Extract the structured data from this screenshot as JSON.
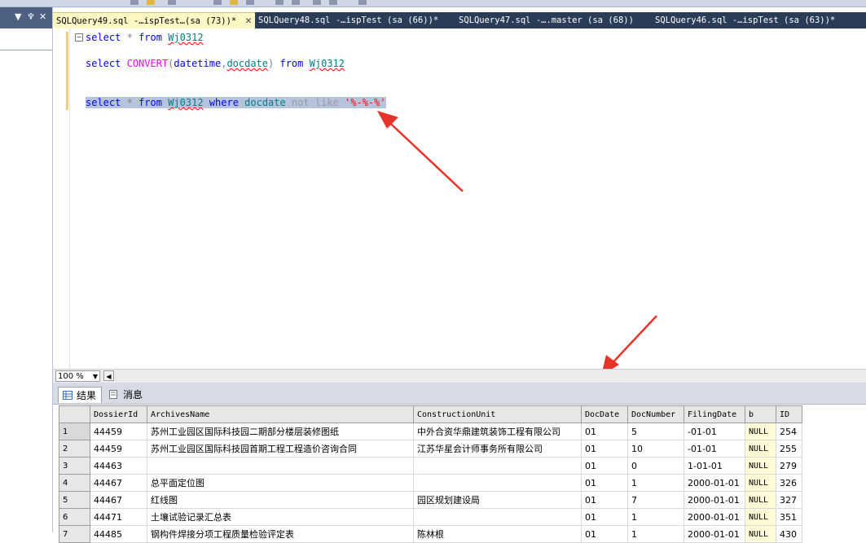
{
  "tabs": [
    {
      "label": "SQLQuery49.sql -…ispTest…(sa (73))*",
      "active": true
    },
    {
      "label": "SQLQuery48.sql -…ispTest (sa (66))*",
      "active": false
    },
    {
      "label": "SQLQuery47.sql -….master (sa (68))",
      "active": false
    },
    {
      "label": "SQLQuery46.sql -…ispTest (sa (63))*",
      "active": false
    }
  ],
  "editor": {
    "line1": {
      "select": "select",
      "star": "*",
      "from": "from",
      "table": "Wj0312"
    },
    "line2": {
      "select": "select",
      "convert": "CONVERT",
      "open": "(",
      "type": "datetime",
      "comma": ",",
      "col": "docdate",
      "close": ")",
      "from": "from",
      "table": "Wj0312"
    },
    "line3": {
      "select": "select",
      "star": "*",
      "from": "from",
      "table": "Wj0312",
      "where": "where",
      "col": "docdate",
      "not": "not",
      "like": "like",
      "pattern": "'%-%-%'"
    }
  },
  "zoom": {
    "value": "100 %"
  },
  "result_tabs": {
    "results": "结果",
    "messages": "消息"
  },
  "grid": {
    "columns": [
      "DossierId",
      "ArchivesName",
      "ConstructionUnit",
      "DocDate",
      "DocNumber",
      "FilingDate",
      "b",
      "ID"
    ],
    "rows": [
      {
        "n": "1",
        "cells": [
          "44459",
          "苏州工业园区国际科技园二期部分楼层装修图纸",
          "中外合资华鼎建筑装饰工程有限公司",
          "01",
          "5",
          "-01-01",
          "NULL",
          "254"
        ]
      },
      {
        "n": "2",
        "cells": [
          "44459",
          "苏州工业园区国际科技园首期工程工程造价咨询合同",
          "江苏华星会计师事务所有限公司",
          "01",
          "10",
          "-01-01",
          "NULL",
          "255"
        ]
      },
      {
        "n": "3",
        "cells": [
          "44463",
          "",
          "",
          "01",
          "0",
          "1-01-01",
          "NULL",
          "279"
        ]
      },
      {
        "n": "4",
        "cells": [
          "44467",
          "总平面定位图",
          "",
          "01",
          "1",
          "2000-01-01",
          "NULL",
          "326"
        ]
      },
      {
        "n": "5",
        "cells": [
          "44467",
          "红线图",
          "园区规划建设局",
          "01",
          "7",
          "2000-01-01",
          "NULL",
          "327"
        ]
      },
      {
        "n": "6",
        "cells": [
          "44471",
          "土壤试验记录汇总表",
          "",
          "01",
          "1",
          "2000-01-01",
          "NULL",
          "351"
        ]
      },
      {
        "n": "7",
        "cells": [
          "44485",
          "钢构件焊接分项工程质量检验评定表",
          "陈林根",
          "01",
          "1",
          "2000-01-01",
          "NULL",
          "430"
        ]
      }
    ]
  },
  "colors": {
    "tab_strip": "#2b3c59",
    "active_tab": "#fff8c4",
    "keyword": "#0000ff",
    "identifier": "#008080",
    "function": "#ff00ff",
    "string": "#ff0000",
    "arrow": "#e8332a",
    "selection": "#b5c3dc"
  }
}
